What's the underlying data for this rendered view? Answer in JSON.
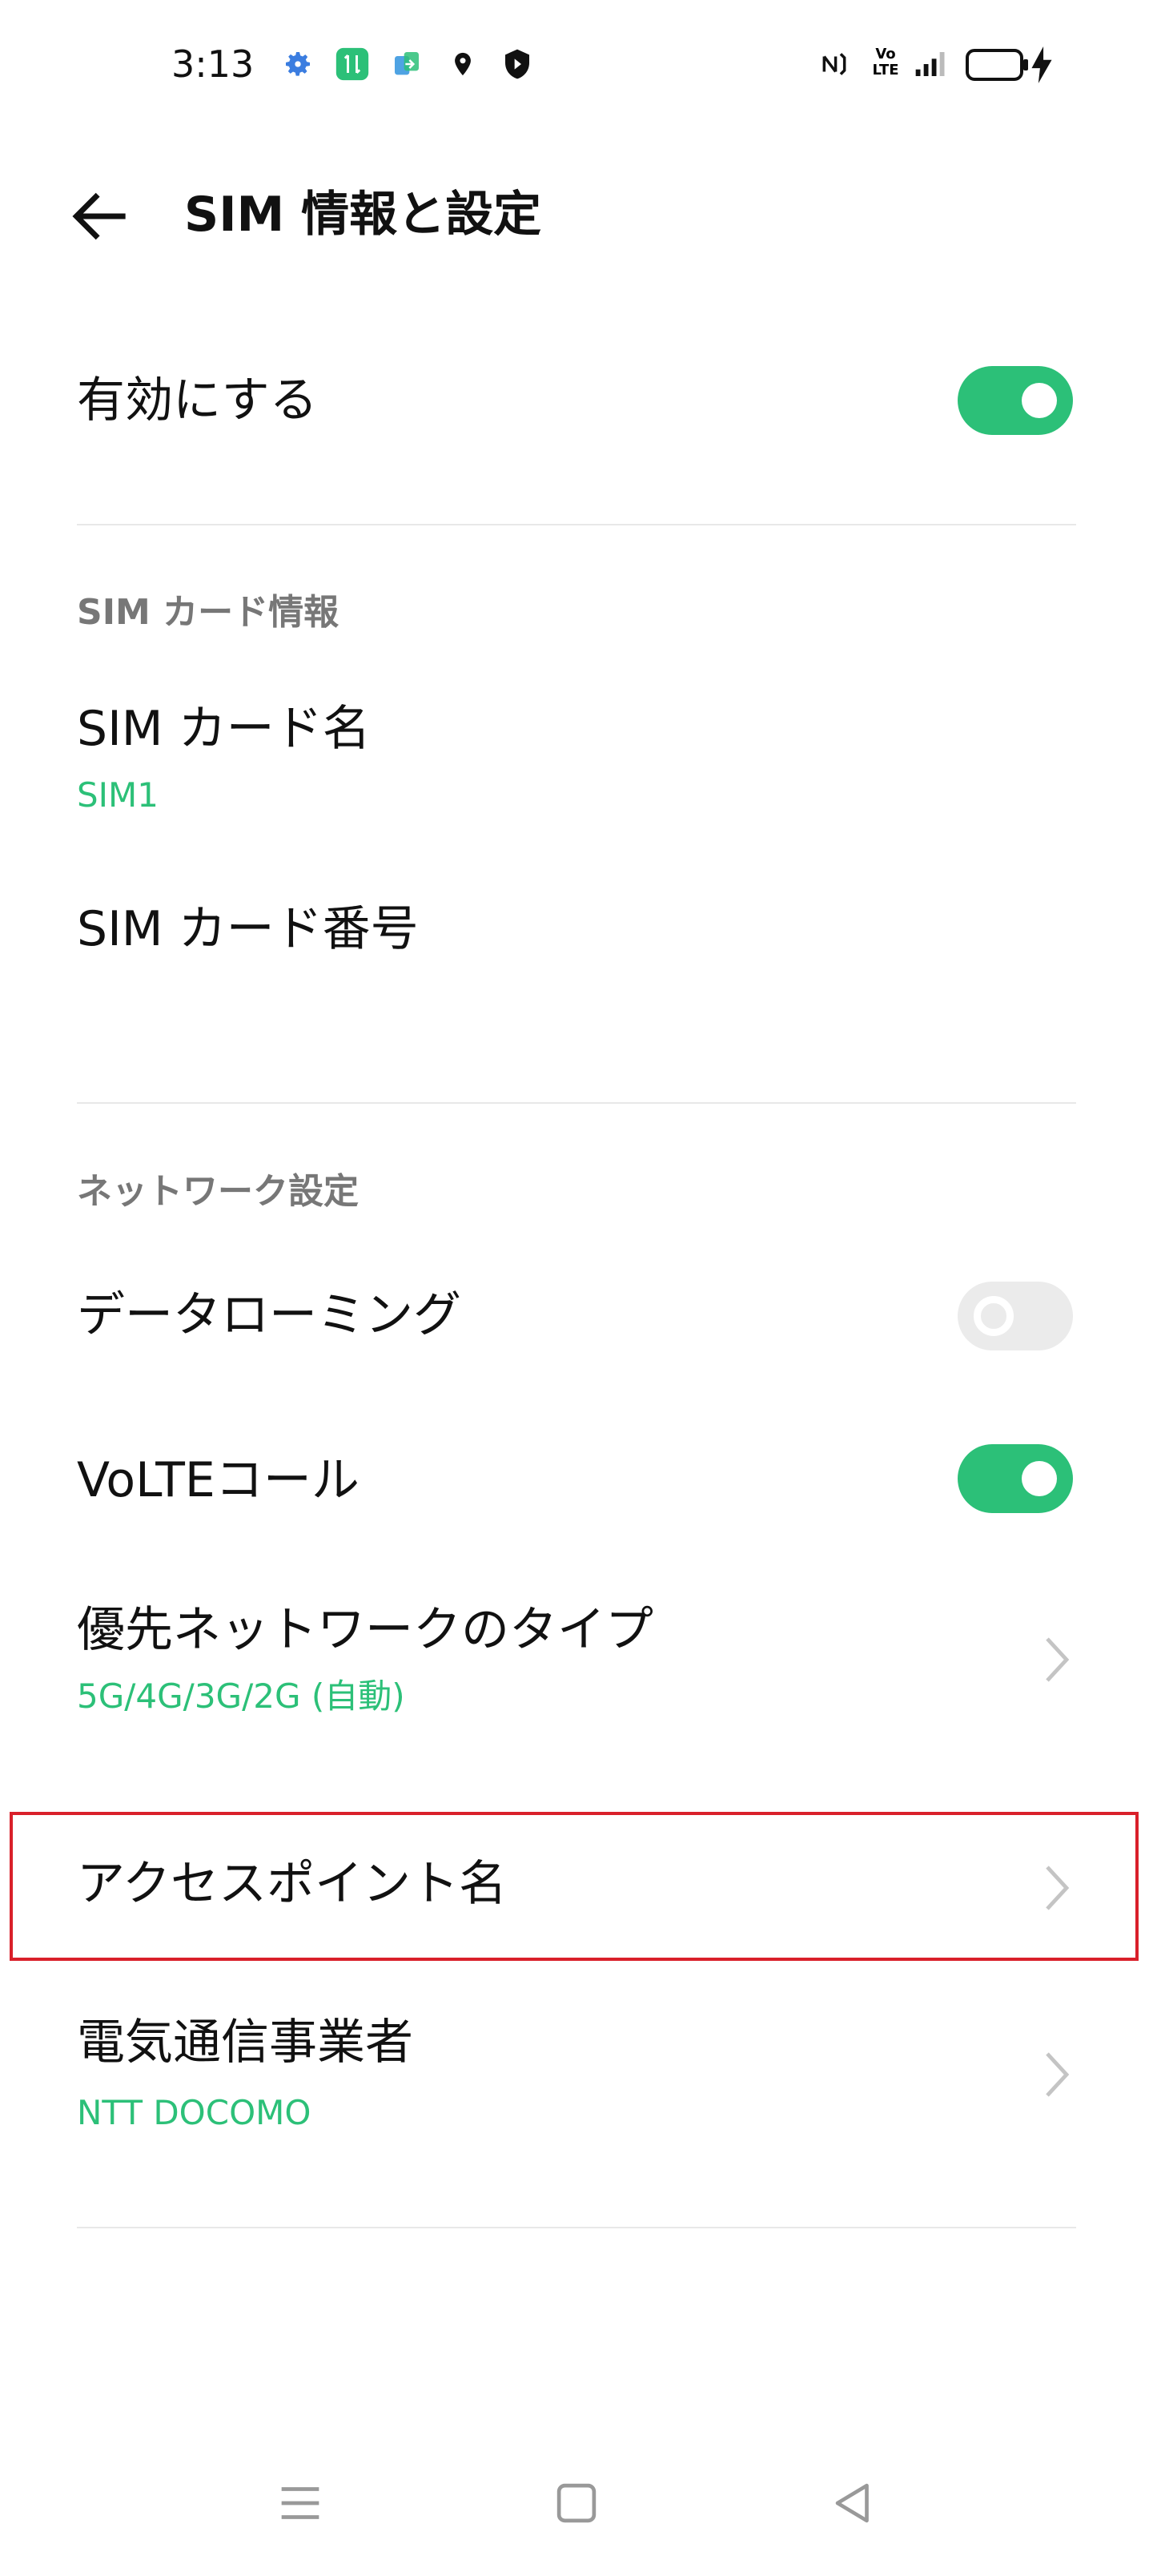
{
  "status_bar": {
    "time": "3:13",
    "left_icons": [
      "settings-gear-icon",
      "data-transfer-icon",
      "app-clone-icon",
      "location-pin-icon",
      "shield-icon"
    ],
    "right_icons": [
      "nfc-icon",
      "volte-icon",
      "signal-icon",
      "battery-icon",
      "charging-bolt-icon"
    ],
    "volte_text_top": "Vo",
    "volte_text_bottom": "LTE"
  },
  "header": {
    "title": "SIM 情報と設定"
  },
  "enable_row": {
    "label": "有効にする",
    "enabled": true
  },
  "sim_section": {
    "heading": "SIM カード情報",
    "card_name_label": "SIM カード名",
    "card_name_value": "SIM1",
    "card_number_label": "SIM カード番号"
  },
  "network_section": {
    "heading": "ネットワーク設定",
    "roaming_label": "データローミング",
    "roaming_enabled": false,
    "volte_label": "VoLTEコール",
    "volte_enabled": true,
    "preferred_network_label": "優先ネットワークのタイプ",
    "preferred_network_value": "5G/4G/3G/2G (自動)",
    "apn_label": "アクセスポイント名",
    "carrier_label": "電気通信事業者",
    "carrier_value": "NTT DOCOMO"
  },
  "colors": {
    "accent": "#2cc078",
    "highlight": "#d9202a"
  },
  "nav_bar": {
    "icons": [
      "menu-lines-icon",
      "home-square-icon",
      "back-triangle-icon"
    ]
  }
}
